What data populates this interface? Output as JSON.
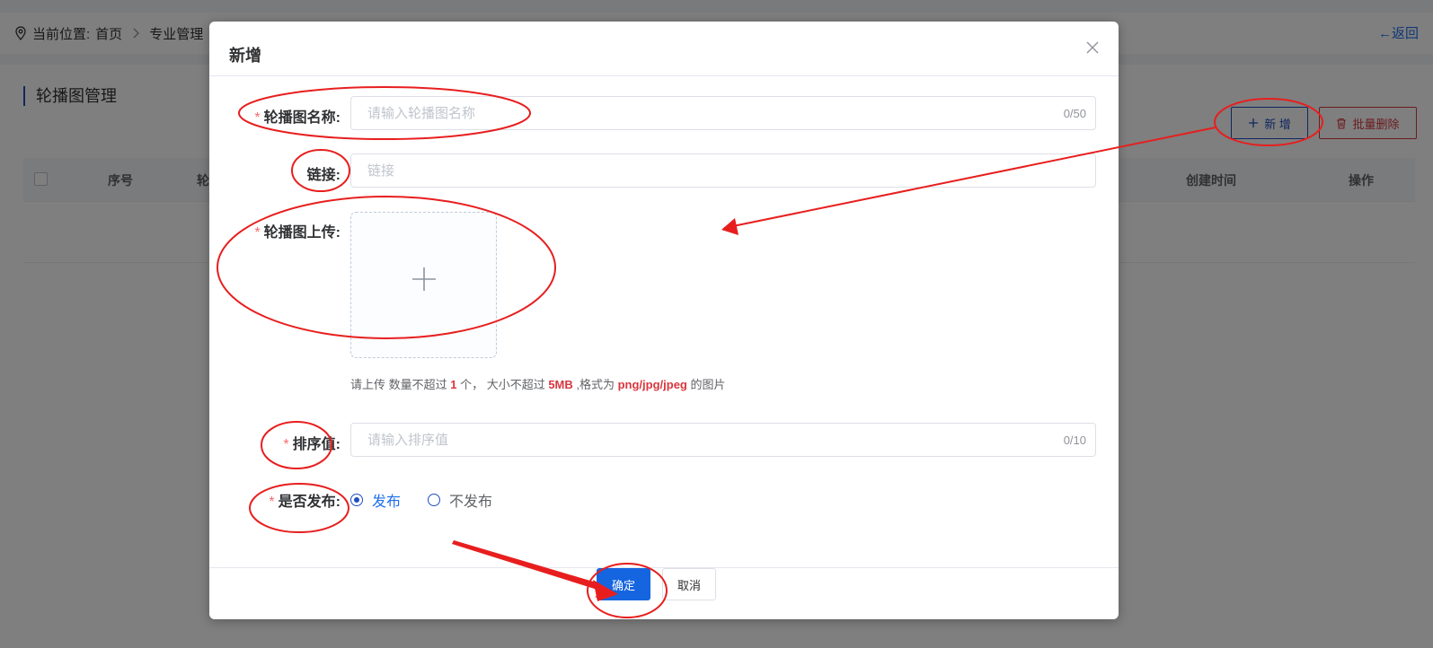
{
  "breadcrumb": {
    "prefix": "当前位置:",
    "items": [
      "首页",
      "专业管理"
    ]
  },
  "back_label": "←返回",
  "page_title": "轮播图管理",
  "toolbar": {
    "add_label": "新 增",
    "batch_delete_label": "批量删除"
  },
  "table": {
    "headers": [
      "序号",
      "轮",
      "创建时间",
      "操作"
    ]
  },
  "dialog": {
    "title": "新增",
    "fields": {
      "name": {
        "label": "轮播图名称:",
        "placeholder": "请输入轮播图名称",
        "counter": "0/50"
      },
      "link": {
        "label": "链接:",
        "placeholder": "链接"
      },
      "upload": {
        "label": "轮播图上传:",
        "tip_prefix": "请上传 数量不超过 ",
        "tip_count": "1",
        "tip_mid": " 个， 大小不超过 ",
        "tip_size": "5MB",
        "tip_mid2": " ,格式为 ",
        "tip_format": "png/jpg/jpeg",
        "tip_suffix": " 的图片"
      },
      "sort": {
        "label": "排序值:",
        "placeholder": "请输入排序值",
        "counter": "0/10"
      },
      "publish": {
        "label": "是否发布:",
        "options": [
          "发布",
          "不发布"
        ],
        "selected": "发布"
      }
    },
    "confirm_label": "确定",
    "cancel_label": "取消"
  },
  "colors": {
    "primary": "#1565e0",
    "danger": "#d9363e",
    "required": "#f56c6c",
    "annotation": "#e81e1e"
  },
  "icons": [
    "location-pin-icon",
    "chevron-right-icon",
    "plus-icon",
    "trash-icon",
    "close-icon"
  ]
}
